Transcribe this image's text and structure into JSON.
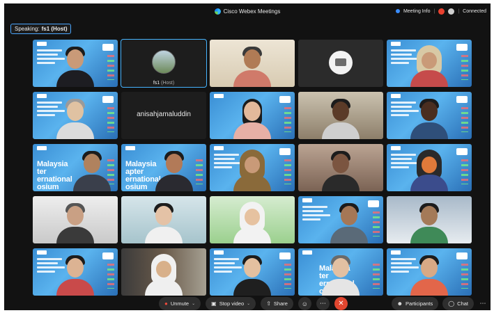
{
  "window": {
    "title": "Cisco Webex Meetings"
  },
  "topbar": {
    "meeting_info": "Meeting Info",
    "separator": "|",
    "status": "Connected"
  },
  "speaking": {
    "label": "Speaking:",
    "name": "fs1 (Host)"
  },
  "participants": [
    {
      "kind": "banner"
    },
    {
      "kind": "avatar",
      "name": "fs1",
      "role": "(Host)"
    },
    {
      "kind": "video"
    },
    {
      "kind": "avatar-only"
    },
    {
      "kind": "banner"
    },
    {
      "kind": "banner"
    },
    {
      "kind": "name-only",
      "name": "anisahjamaluddin"
    },
    {
      "kind": "banner"
    },
    {
      "kind": "video"
    },
    {
      "kind": "banner"
    },
    {
      "kind": "banner-text",
      "text": "Malaysia ter ernational osium"
    },
    {
      "kind": "banner-text",
      "text": "Malaysia apter ernational osium"
    },
    {
      "kind": "banner"
    },
    {
      "kind": "video"
    },
    {
      "kind": "banner"
    },
    {
      "kind": "video"
    },
    {
      "kind": "video"
    },
    {
      "kind": "video"
    },
    {
      "kind": "banner"
    },
    {
      "kind": "video"
    },
    {
      "kind": "banner"
    },
    {
      "kind": "video"
    },
    {
      "kind": "banner"
    },
    {
      "kind": "banner-text",
      "text": "Malaysia ter ernational osium"
    },
    {
      "kind": "banner"
    }
  ],
  "toolbar": {
    "unmute": "Unmute",
    "stop_video": "Stop video",
    "share": "Share",
    "participants": "Participants",
    "chat": "Chat"
  },
  "icons": {
    "mic": "mic-icon",
    "video": "video-camera-icon",
    "share": "share-icon",
    "reactions": "emoji-icon",
    "more": "more-icon",
    "end": "close-icon",
    "participants": "people-icon",
    "chat": "chat-icon"
  },
  "colors": {
    "accent": "#46b4ff",
    "end_call": "#e1462f",
    "mute": "#ef4b3c"
  }
}
